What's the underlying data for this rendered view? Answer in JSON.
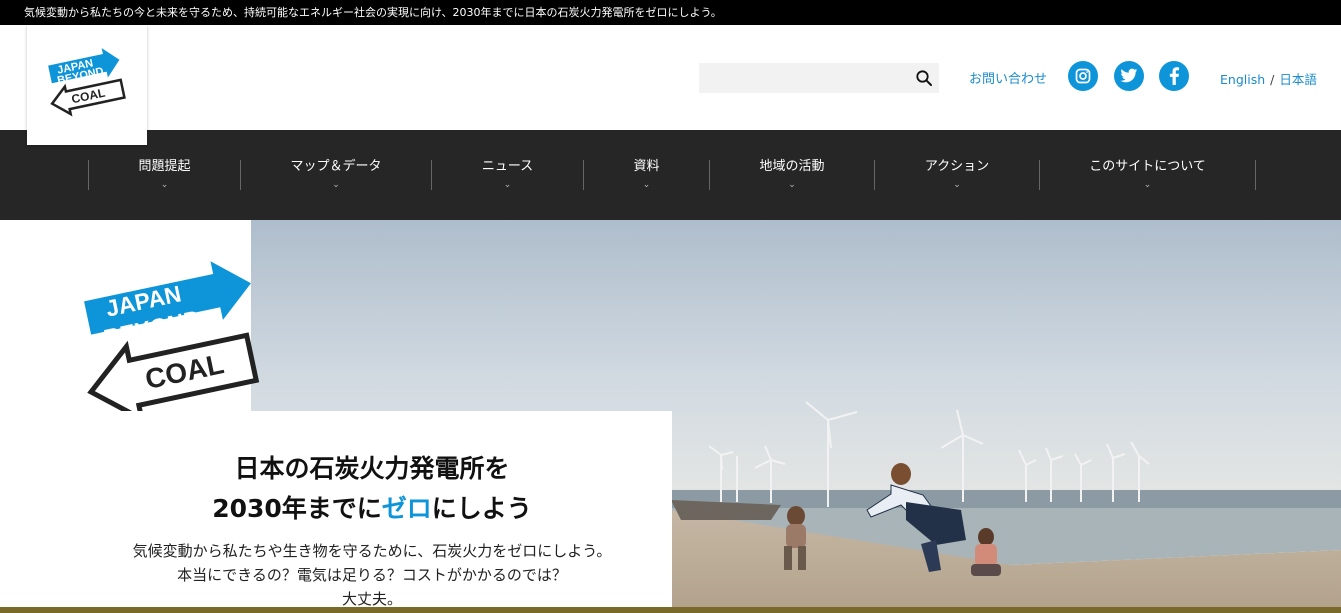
{
  "topbar": {
    "text": "気候変動から私たちの今と未来を守るため、持続可能なエネルギー社会の実現に向け、2030年までに日本の石炭火力発電所をゼロにしよう。"
  },
  "brand": {
    "line1": "JAPAN",
    "line2": "BEYOND",
    "line3": "COAL"
  },
  "header": {
    "search_value": "",
    "search_placeholder": "",
    "contact_label": "お問い合わせ",
    "lang_en": "English",
    "lang_sep": "/",
    "lang_ja": "日本語"
  },
  "nav": {
    "items": [
      {
        "label": "問題提起",
        "chevron": "⌄"
      },
      {
        "label": "マップ＆データ",
        "chevron": "⌄"
      },
      {
        "label": "ニュース",
        "chevron": "⌄"
      },
      {
        "label": "資料",
        "chevron": "⌄"
      },
      {
        "label": "地域の活動",
        "chevron": "⌄"
      },
      {
        "label": "アクション",
        "chevron": "⌄"
      },
      {
        "label": "このサイトについて",
        "chevron": "⌄"
      }
    ]
  },
  "hero": {
    "title_line1": "日本の石炭火力発電所を",
    "title_line2_pre": "2030年までに",
    "title_line2_accent": "ゼロ",
    "title_line2_post": "にしよう",
    "lead_line1": "気候変動から私たちや生き物を守るために、石炭火力をゼロにしよう。",
    "lead_line2": "本当にできるの？電気は足りる？コストがかかるのでは？",
    "lead_line3": "大丈夫。"
  },
  "colors": {
    "accent": "#0e94d8",
    "nav_bg": "#262626",
    "topbar_bg": "#000000",
    "bottom_bar": "#7a6a2a"
  },
  "icons": {
    "search": "search-icon",
    "instagram": "instagram-icon",
    "twitter": "twitter-icon",
    "facebook": "facebook-icon"
  }
}
